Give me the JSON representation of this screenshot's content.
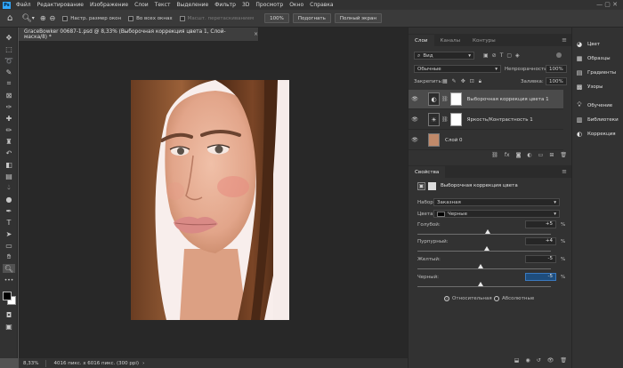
{
  "menubar": {
    "logo": "Ps",
    "items": [
      "Файл",
      "Редактирование",
      "Изображение",
      "Слои",
      "Текст",
      "Выделение",
      "Фильтр",
      "3D",
      "Просмотр",
      "Окно",
      "Справка"
    ]
  },
  "options": {
    "chk_resize": "Настр. размер окон",
    "chk_all": "Во всех окнах",
    "chk_scrubby": "Масшт. перетаскиванием",
    "btn_100": "100%",
    "btn_fit": "Подогнать",
    "btn_full": "Полный экран"
  },
  "document": {
    "tab_title": "GraceBowker 00687-1.psd @ 8,33% (Выборочная коррекция цвета 1, Слой-маска/8) *",
    "close": "×",
    "zoom": "8,33%",
    "info": "4016 пикс. x 6016 пикс. (300 ppi)"
  },
  "layers_panel": {
    "tabs": [
      "Слои",
      "Каналы",
      "Контуры"
    ],
    "search_kind": "Вид",
    "blend_mode": "Обычные",
    "opacity_label": "Непрозрачность:",
    "opacity_value": "100%",
    "lock_label": "Закрепить:",
    "fill_label": "Заливка:",
    "fill_value": "100%",
    "layers": [
      {
        "name": "Выборочная коррекция цвета 1",
        "type": "adjustment"
      },
      {
        "name": "Яркость/Контрастность 1",
        "type": "adjustment"
      },
      {
        "name": "Слой 0",
        "type": "pixel"
      }
    ]
  },
  "properties_panel": {
    "tab": "Свойства",
    "title": "Выборочная коррекция цвета",
    "preset_label": "Набор:",
    "preset_value": "Заказная",
    "colors_label": "Цвета:",
    "colors_value": "Черные",
    "sliders": [
      {
        "label": "Голубой:",
        "value": "+5",
        "unit": "%",
        "level": 0.525
      },
      {
        "label": "Пурпурный:",
        "value": "+4",
        "unit": "%",
        "level": 0.52
      },
      {
        "label": "Желтый:",
        "value": "-5",
        "unit": "%",
        "level": 0.475
      },
      {
        "label": "Черный:",
        "value": "-5",
        "unit": "%",
        "level": 0.475
      }
    ],
    "radio_relative": "Относительная",
    "radio_absolute": "Абсолютные"
  },
  "right_panels": {
    "items": [
      "Цвет",
      "Образцы",
      "Градиенты",
      "Узоры",
      "Обучение",
      "Библиотеки",
      "Коррекция"
    ]
  },
  "colors": {
    "accent": "#31a8ff",
    "highlight": "#1e4d7d"
  }
}
